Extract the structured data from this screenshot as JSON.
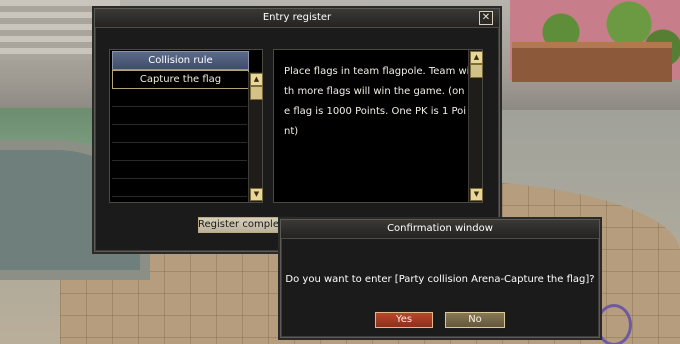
{
  "entry_register": {
    "title": "Entry register",
    "close_symbol": "✕",
    "list": {
      "header": "Collision rule",
      "items": [
        "Capture the flag"
      ]
    },
    "description": "Place flags in team flagpole. Team with more flags will win the game. (one flag is 1000 Points. One PK is 1 Point)",
    "register_button": "Register completion"
  },
  "confirmation": {
    "title": "Confirmation window",
    "message": "Do you want to enter [Party collision Arena-Capture the flag]?",
    "yes": "Yes",
    "no": "No"
  },
  "icons": {
    "close": "close-icon",
    "scroll_up": "arrow-up-icon",
    "scroll_down": "arrow-down-icon"
  },
  "colors": {
    "header_row": "#4a5878",
    "yes_button": "#a63f25",
    "no_button": "#7a6c48",
    "window_bg": "#1b1b1b"
  }
}
